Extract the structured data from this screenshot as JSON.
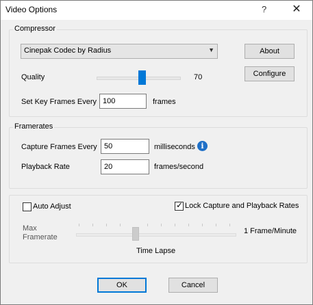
{
  "window": {
    "title": "Video Options",
    "help_glyph": "?",
    "close_glyph": "✕"
  },
  "compressor": {
    "legend": "Compressor",
    "codec": "Cinepak Codec by Radius",
    "about_label": "About",
    "configure_label": "Configure",
    "quality_label": "Quality",
    "quality_value": "70",
    "quality_level": 70,
    "keyframes_label": "Set Key Frames Every",
    "keyframes_value": "100",
    "keyframes_unit": "frames"
  },
  "framerates": {
    "legend": "Framerates",
    "capture_label": "Capture Frames Every",
    "capture_value": "50",
    "capture_unit": "milliseconds",
    "info_glyph": "i",
    "playback_label": "Playback Rate",
    "playback_value": "20",
    "playback_unit": "frames/second"
  },
  "timelapse": {
    "auto_adjust_label": "Auto Adjust",
    "auto_adjust_checked": false,
    "lock_label": "Lock Capture and Playback Rates",
    "lock_checked": true,
    "check_glyph": "✓",
    "max_label_line1": "Max",
    "max_label_line2": "Framerate",
    "min_label": "1 Frame/Minute",
    "slider_caption": "Time Lapse"
  },
  "footer": {
    "ok_label": "OK",
    "cancel_label": "Cancel"
  }
}
